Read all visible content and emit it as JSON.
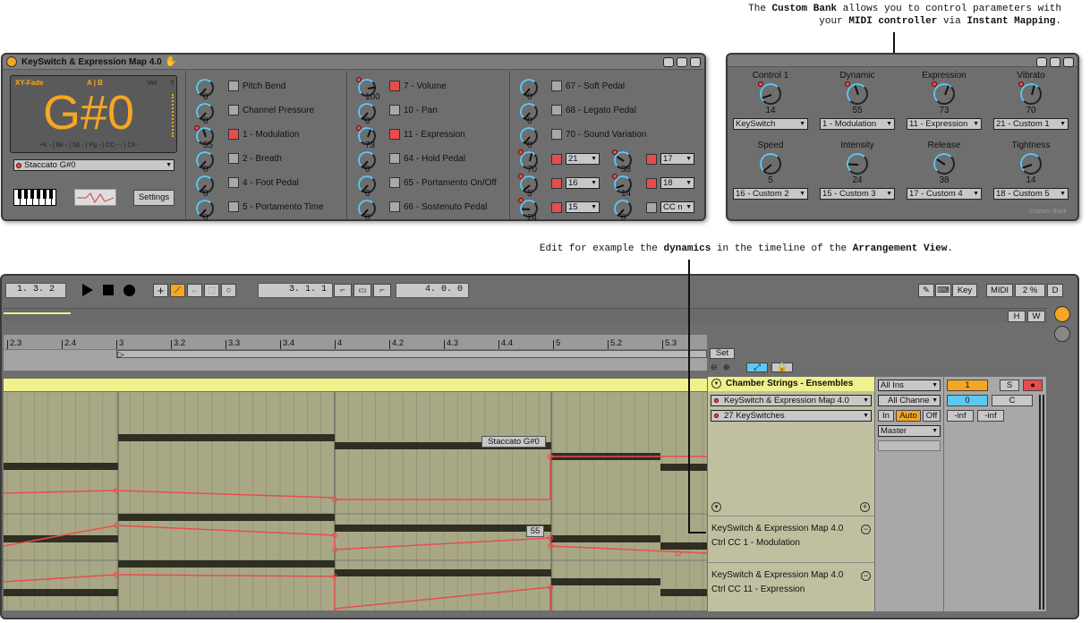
{
  "annotations": {
    "top_l1a": "The ",
    "top_l1b": "Custom Bank",
    "top_l1c": " allows you to control parameters with",
    "top_l2a": "your ",
    "top_l2b": "MIDI controller",
    "top_l2c": " via ",
    "top_l2d": "Instant Mapping",
    ".": ".",
    "mid_a": "Edit for example the ",
    "mid_b": "dynamics",
    "mid_c": " in the timeline of the ",
    "mid_d": "Arrangement View",
    "mid_e": "."
  },
  "device": {
    "title": "KeySwitch & Expression Map 4.0",
    "xy_fade": "XY-Fade",
    "ab": "A | B",
    "vel": "Vel",
    "y": "Y",
    "note": "G#0",
    "legend": "+K - | Bk - | Sb - | Pg - | CC - - | Ch -",
    "articulation": "Staccato G#0",
    "settings": "Settings",
    "col1": [
      {
        "val": "0",
        "label": "Pitch Bend",
        "on": false
      },
      {
        "val": "0",
        "label": "Channel Pressure",
        "on": false
      },
      {
        "val": "55",
        "label": "1 - Modulation",
        "on": true
      },
      {
        "val": "0",
        "label": "2 - Breath",
        "on": false
      },
      {
        "val": "0",
        "label": "4 - Foot Pedal",
        "on": false
      },
      {
        "val": "0",
        "label": "5 - Portamento Time",
        "on": false
      }
    ],
    "col2": [
      {
        "val": "100",
        "label": "7 - Volume",
        "on": true
      },
      {
        "val": "0",
        "label": "10 - Pan",
        "on": false
      },
      {
        "val": "73",
        "label": "11 - Expression",
        "on": true
      },
      {
        "val": "0",
        "label": "64 - Hold Pedal",
        "on": false
      },
      {
        "val": "0",
        "label": "65 - Portamento On/Off",
        "on": false
      },
      {
        "val": "0",
        "label": "66 - Sostenuto Pedal",
        "on": false
      }
    ],
    "col3": [
      {
        "val": "0",
        "label": "67 - Soft Pedal"
      },
      {
        "val": "0",
        "label": "68 - Legato Pedal"
      },
      {
        "val": "0",
        "label": "70 - Sound Variation"
      }
    ],
    "col3b": [
      {
        "v1": "70",
        "d1": "21",
        "v2": "38",
        "d2": "17"
      },
      {
        "v1": "5",
        "d1": "16",
        "v2": "14",
        "d2": "18"
      },
      {
        "v1": "24",
        "d1": "15",
        "v2": "0",
        "d2": "CC n"
      }
    ]
  },
  "bank": {
    "footer": "Custom Bank",
    "knobs": [
      {
        "name": "Control 1",
        "val": "14",
        "sel": "KeySwitch"
      },
      {
        "name": "Dynamic",
        "val": "55",
        "sel": "1 - Modulation"
      },
      {
        "name": "Expression",
        "val": "73",
        "sel": "11 - Expression"
      },
      {
        "name": "Vibrato",
        "val": "70",
        "sel": "21 - Custom 1"
      },
      {
        "name": "Speed",
        "val": "5",
        "sel": "16 - Custom 2"
      },
      {
        "name": "Intensity",
        "val": "24",
        "sel": "15 - Custom 3"
      },
      {
        "name": "Release",
        "val": "38",
        "sel": "17 - Custom 4"
      },
      {
        "name": "Tightness",
        "val": "14",
        "sel": "18 - Custom 5"
      }
    ]
  },
  "arrangement": {
    "pos": "1.  3.  2",
    "loop_start": "3.  1.  1",
    "loop_len": "4.  0.  0",
    "key": "Key",
    "midi": "MIDI",
    "zoom": "2 %",
    "d": "D",
    "h": "H",
    "w": "W",
    "ruler": [
      "2.3",
      "2.4",
      "3",
      "3.2",
      "3.3",
      "3.4",
      "4",
      "4.2",
      "4.3",
      "4.4",
      "5",
      "5.2",
      "5.3"
    ],
    "set": "Set",
    "track_name": "Chamber Strings - Ensembles",
    "device_sel": "KeySwitch & Expression Map 4.0",
    "chain_sel": "27 KeySwitches",
    "input": "All Ins",
    "channel": "All Channe",
    "in": "In",
    "auto": "Auto",
    "off": "Off",
    "out": "Master",
    "track_num": "1",
    "solo": "S",
    "vol": "0",
    "pan": "C",
    "inf1": "-inf",
    "inf2": "-inf",
    "clip_label": "Staccato G#0",
    "val_label": "55",
    "lane1_dev": "KeySwitch & Expression Map 4.0",
    "lane1_ctrl": "Ctrl CC  1 - Modulation",
    "lane2_dev": "KeySwitch & Expression Map 4.0",
    "lane2_ctrl": "Ctrl CC 11 - Expression"
  },
  "colors": {
    "accent": "#f5a623",
    "red": "#e84d4d",
    "track": "#f0f08c",
    "cyan": "#5fc8f0"
  }
}
